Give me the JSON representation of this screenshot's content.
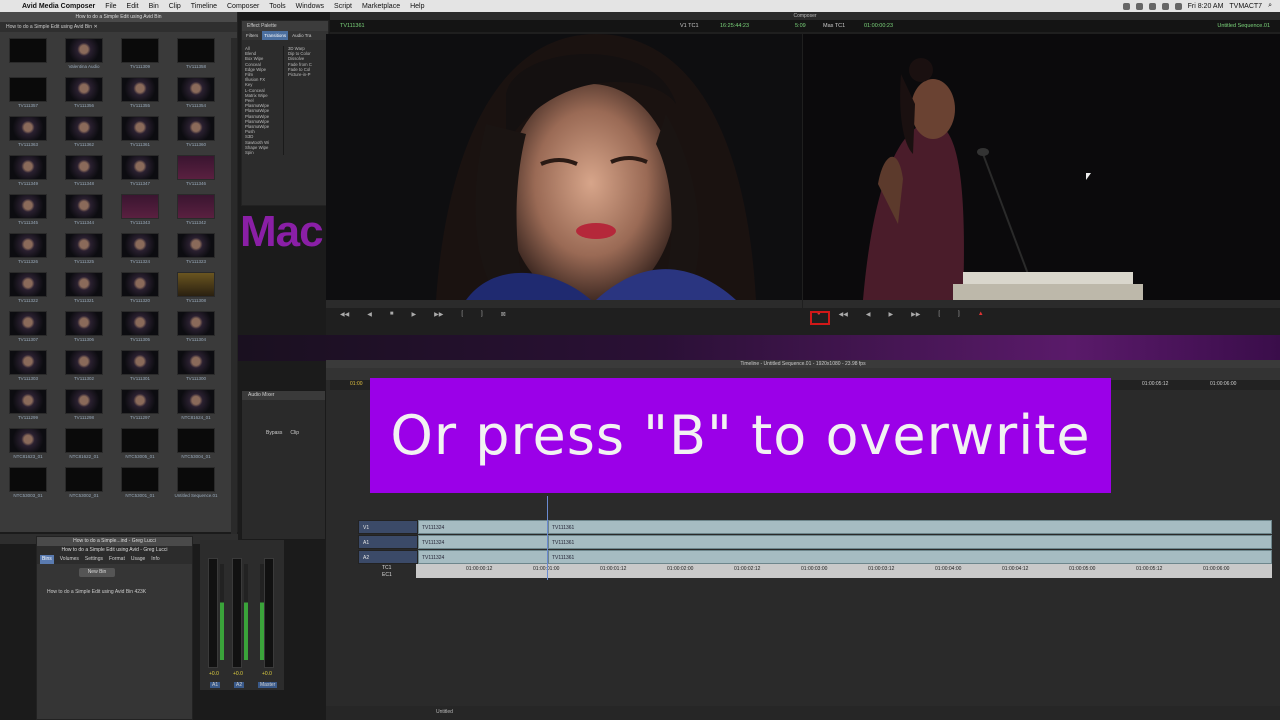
{
  "menubar": {
    "app_name": "Avid Media Composer",
    "menus": [
      "File",
      "Edit",
      "Bin",
      "Clip",
      "Timeline",
      "Composer",
      "Tools",
      "Windows",
      "Script",
      "Marketplace",
      "Help"
    ],
    "clock": "Fri 8:20 AM",
    "user": "TVMACT7"
  },
  "bin": {
    "title": "How to do a Simple Edit using Avid Bin",
    "tab": "How to do a Simple Edit using Avid Bin",
    "clips": [
      {
        "label": "",
        "style": "dark"
      },
      {
        "label": "Valentina Audio",
        "style": "face"
      },
      {
        "label": "TV111309",
        "style": "dark"
      },
      {
        "label": "TV111358",
        "style": "dark"
      },
      {
        "label": "TV111357",
        "style": "dark"
      },
      {
        "label": "TV111356",
        "style": "face"
      },
      {
        "label": "TV111355",
        "style": "face"
      },
      {
        "label": "TV111354",
        "style": "face"
      },
      {
        "label": "TV111363",
        "style": "face"
      },
      {
        "label": "TV111362",
        "style": "face"
      },
      {
        "label": "TV111361",
        "style": "face"
      },
      {
        "label": "TV111360",
        "style": "face"
      },
      {
        "label": "TV111349",
        "style": "face"
      },
      {
        "label": "TV111348",
        "style": "face"
      },
      {
        "label": "TV111347",
        "style": "face"
      },
      {
        "label": "TV111346",
        "style": "purple"
      },
      {
        "label": "TV111345",
        "style": "face"
      },
      {
        "label": "TV111344",
        "style": "face"
      },
      {
        "label": "TV111343",
        "style": "purple"
      },
      {
        "label": "TV111342",
        "style": "purple"
      },
      {
        "label": "TV111326",
        "style": "face"
      },
      {
        "label": "TV111325",
        "style": "face"
      },
      {
        "label": "TV111324",
        "style": "face"
      },
      {
        "label": "TV111323",
        "style": "face"
      },
      {
        "label": "TV111322",
        "style": "face"
      },
      {
        "label": "TV111321",
        "style": "face"
      },
      {
        "label": "TV111320",
        "style": "face"
      },
      {
        "label": "TV111308",
        "style": "gold"
      },
      {
        "label": "TV111307",
        "style": "face"
      },
      {
        "label": "TV111306",
        "style": "face"
      },
      {
        "label": "TV111305",
        "style": "face"
      },
      {
        "label": "TV111304",
        "style": "face"
      },
      {
        "label": "TV111303",
        "style": "face"
      },
      {
        "label": "TV111302",
        "style": "face"
      },
      {
        "label": "TV111301",
        "style": "face"
      },
      {
        "label": "TV111300",
        "style": "face"
      },
      {
        "label": "TV111299",
        "style": "face"
      },
      {
        "label": "TV111298",
        "style": "face"
      },
      {
        "label": "TV111297",
        "style": "face"
      },
      {
        "label": "NTC81624_01",
        "style": "face"
      },
      {
        "label": "NTC81623_01",
        "style": "face"
      },
      {
        "label": "NTC81622_01",
        "style": "dark"
      },
      {
        "label": "NTC53005_01",
        "style": "dark"
      },
      {
        "label": "NTC53004_01",
        "style": "dark"
      },
      {
        "label": "NTC53003_01",
        "style": "dark"
      },
      {
        "label": "NTC53002_01",
        "style": "dark"
      },
      {
        "label": "NTC53001_01",
        "style": "dark"
      },
      {
        "label": "Untitled Sequence.01",
        "style": "dark"
      }
    ]
  },
  "project": {
    "title": "How to do a Simple...ind - Greg Lucci",
    "subtitle": "How to do a Simple Edit using Avid - Greg Lucci",
    "tabs": [
      "Bins",
      "Volumes",
      "Settings",
      "Format",
      "Usage",
      "Info"
    ],
    "new_bin_label": "New Bin",
    "file_name": "How to do a Simple Edit using Avid Bin",
    "file_size": "423K"
  },
  "effects": {
    "title": "Effect Palette",
    "tabs": [
      "Filters",
      "Transitions",
      "Audio Tra"
    ],
    "categories": [
      "All",
      "Blend",
      "Box Wipe",
      "Conceal",
      "Edge Wipe",
      "Film",
      "Illusion FX",
      "Key",
      "L-Conceal",
      "Matrix Wipe",
      "Peel",
      "PlasmaWipe",
      "PlasmaWipe",
      "PlasmaWipe",
      "PlasmaWipe",
      "PlasmaWipe",
      "Push",
      "S3D",
      "Sawtooth Wi",
      "Shape Wipe",
      "Spin"
    ],
    "effects": [
      "3D Warp",
      "Dip to Color",
      "Dissolve",
      "Fade from C",
      "Fade to Col",
      "Picture-in-P"
    ],
    "mac_text": "Mac"
  },
  "composer": {
    "title": "Composer",
    "source_clip": "TV111361",
    "v1_label": "V1 TC1",
    "src_tc": "16:25:44:23",
    "src_dur": "5:09",
    "mas_label": "Mas TC1",
    "rec_tc": "01:00:00:23",
    "sequence_name": "Untitled Sequence.01"
  },
  "mixer": {
    "title": "Audio Mixer",
    "bypass": "Bypass",
    "clip_label": "Clip",
    "channels": [
      "A1",
      "A2",
      "Master"
    ],
    "levels": [
      "+0.0",
      "+0.0",
      "+0.0"
    ]
  },
  "timeline": {
    "title": "Timeline - Untitled Sequence.01 - 1920x1080 - 23.98 fps",
    "tc_start": "01:00",
    "ruler_marks": [
      "01:00:05:12",
      "01:00:06:00"
    ],
    "tracks": [
      {
        "name": "V1",
        "clips": [
          "TV111324",
          "TV111361"
        ]
      },
      {
        "name": "A1",
        "clips": [
          "TV111324",
          "TV111361"
        ]
      },
      {
        "name": "A2",
        "clips": [
          "TV111324",
          "TV111361"
        ]
      }
    ],
    "tc1_label": "TC1",
    "ec1_label": "EC1",
    "tc_marks": [
      "01:00:00:12",
      "01:00:01:00",
      "01:00:01:12",
      "01:00:02:00",
      "01:00:02:12",
      "01:00:03:00",
      "01:00:03:12",
      "01:00:04:00",
      "01:00:04:12",
      "01:00:05:00",
      "01:00:05:12",
      "01:00:06:00"
    ],
    "footer_label": "Untitled"
  },
  "caption": {
    "text": "Or press \"B\" to overwrite"
  },
  "colors": {
    "caption_bg": "#9b00e8",
    "track_clip": "#a6bcc2",
    "track_head": "#3b4a68",
    "timecode_green": "#7cd67c"
  }
}
